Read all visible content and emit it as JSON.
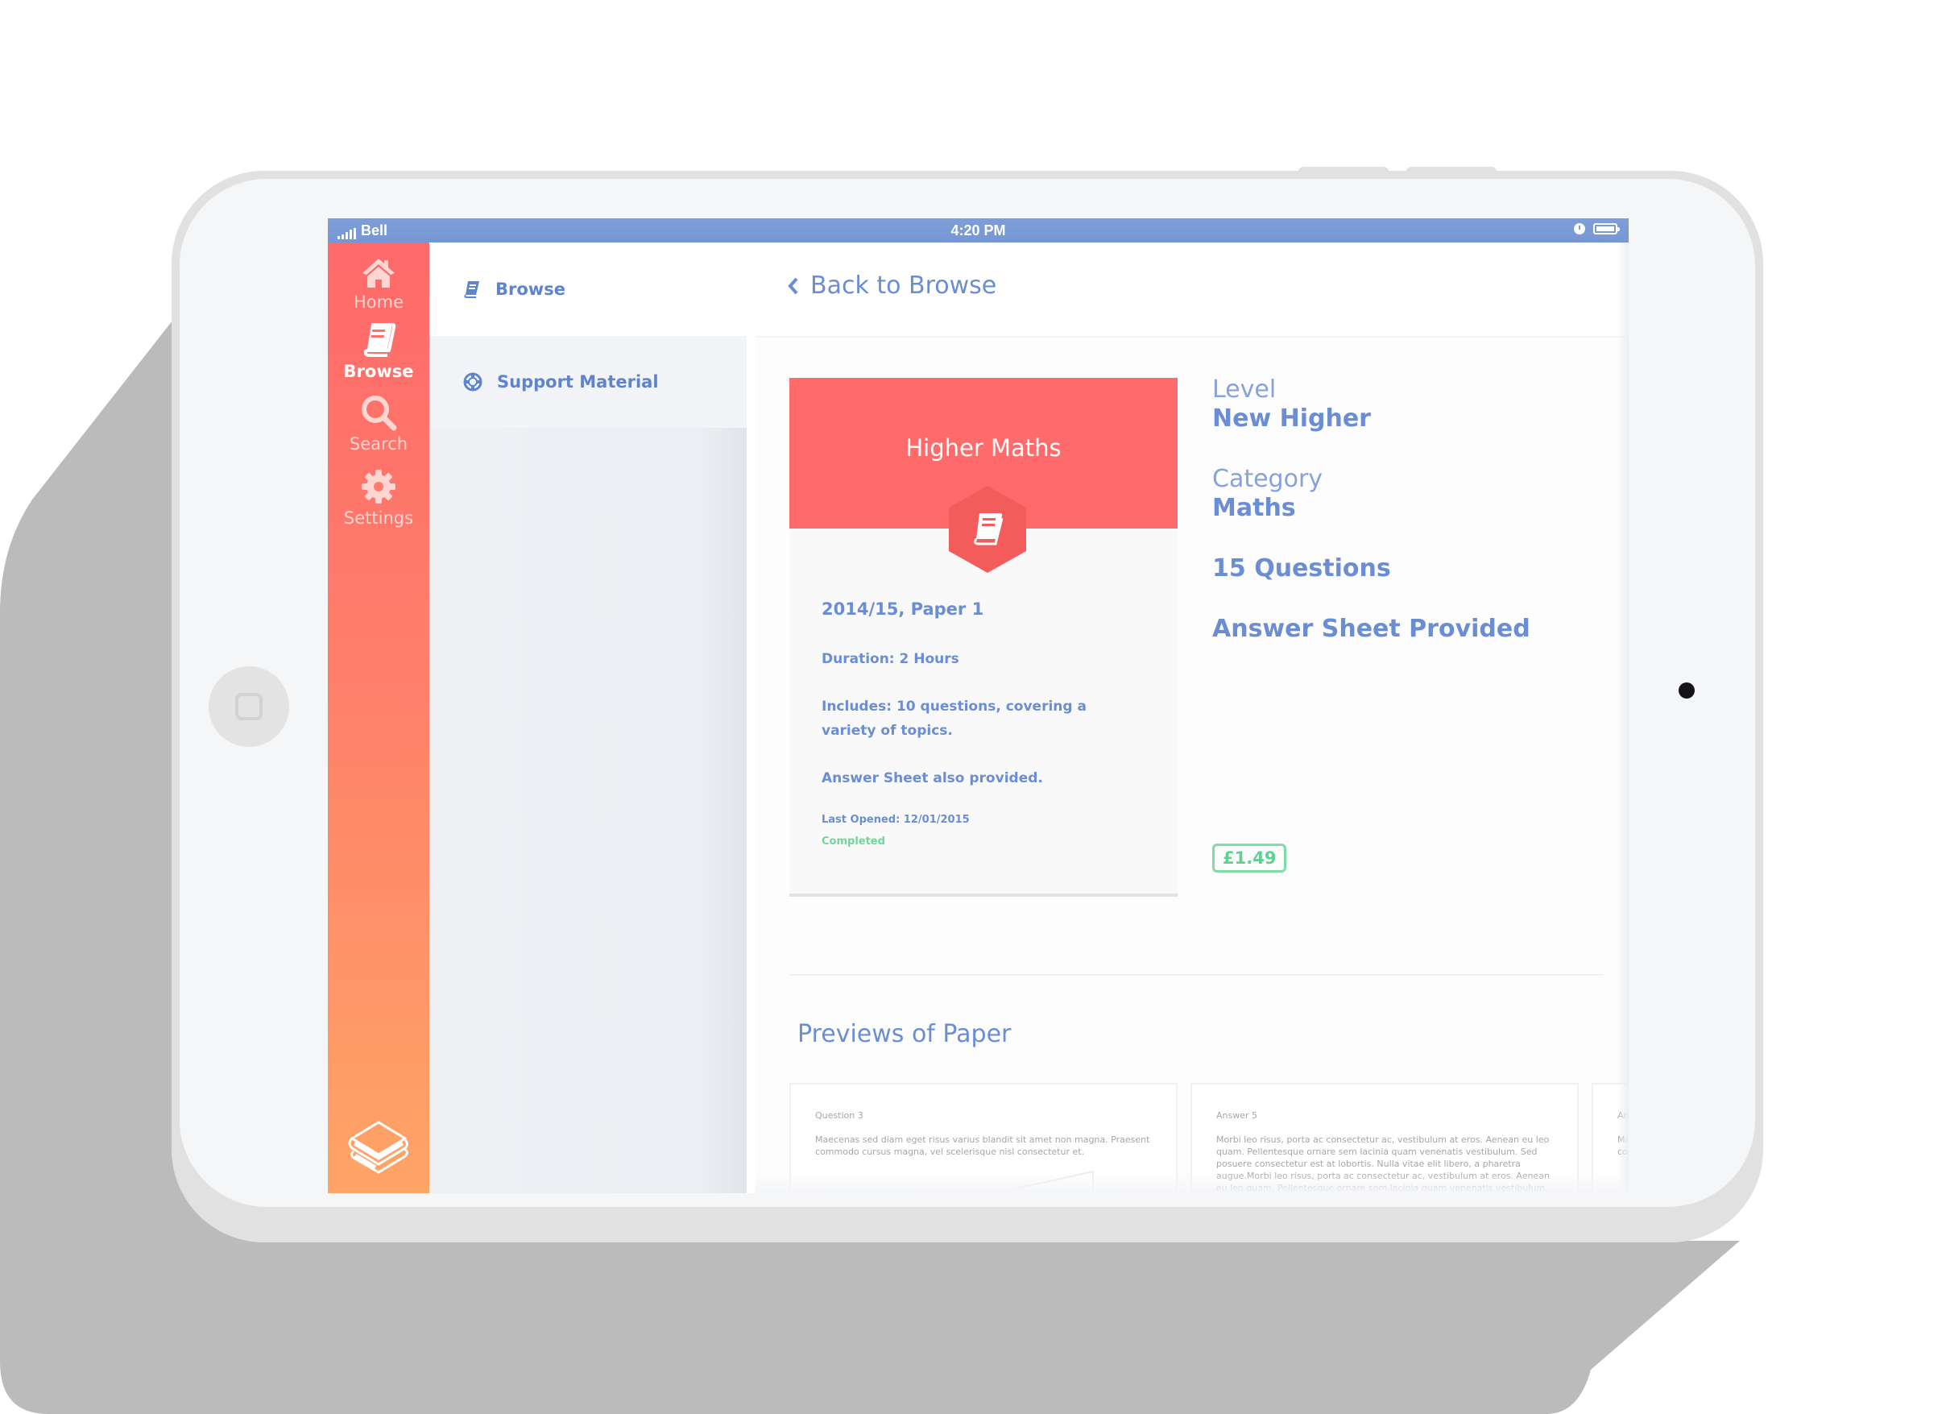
{
  "status_bar": {
    "carrier": "Bell",
    "time": "4:20 PM"
  },
  "rail": {
    "items": [
      {
        "label": "Home",
        "icon": "home-icon",
        "active": false
      },
      {
        "label": "Browse",
        "icon": "book-icon",
        "active": true
      },
      {
        "label": "Search",
        "icon": "search-icon",
        "active": false
      },
      {
        "label": "Settings",
        "icon": "gear-icon",
        "active": false
      }
    ],
    "logo_icon": "books-stack-icon"
  },
  "subnav": {
    "items": [
      {
        "label": "Browse",
        "icon": "book-icon",
        "active": true
      },
      {
        "label": "Support Material",
        "icon": "lifebuoy-icon",
        "active": false
      }
    ]
  },
  "header": {
    "back_label": "Back to Browse"
  },
  "paper_card": {
    "title": "Higher Maths",
    "year_paper": "2014/15, Paper 1",
    "duration": "Duration: 2 Hours",
    "includes": "Includes: 10 questions, covering a variety of topics.",
    "answer_note": "Answer Sheet also provided.",
    "last_opened": "Last Opened: 12/01/2015",
    "status": "Completed"
  },
  "details": {
    "level_label": "Level",
    "level_value": "New Higher",
    "category_label": "Category",
    "category_value": "Maths",
    "questions": "15 Questions",
    "answer_sheet": "Answer Sheet Provided",
    "price": "£1.49"
  },
  "colors": {
    "accent_blue": "#6a8dd4",
    "coral": "#ff6b6b",
    "orange": "#ffa566",
    "success_green": "#5fd193",
    "status_bar": "#7b9bd6"
  },
  "previews": {
    "title": "Previews of Paper",
    "cards": [
      {
        "title": "Question 3",
        "body": "Maecenas sed diam eget risus varius blandit sit amet non magna. Praesent commodo cursus magna, vel scelerisque nisl consectetur et."
      },
      {
        "title": "Answer 5",
        "body": "Morbi leo risus, porta ac consectetur ac, vestibulum at eros. Aenean eu leo quam. Pellentesque ornare sem lacinia quam venenatis vestibulum. Sed posuere consectetur est at lobortis. Nulla vitae elit libero, a pharetra augue.Morbi leo risus, porta ac consectetur ac, vestibulum at eros. Aenean eu leo quam. Pellentesque ornare sem lacinia quam venenatis vestibulum. Sed posuere consectetur est at lobortis. Nulla vitae elit libero, a pharetra augue."
      },
      {
        "title": "Answer",
        "body": "Maecenas sed diam eget risus varius blandit sit amet non magna. Praesent commodo cursus magna."
      }
    ]
  }
}
